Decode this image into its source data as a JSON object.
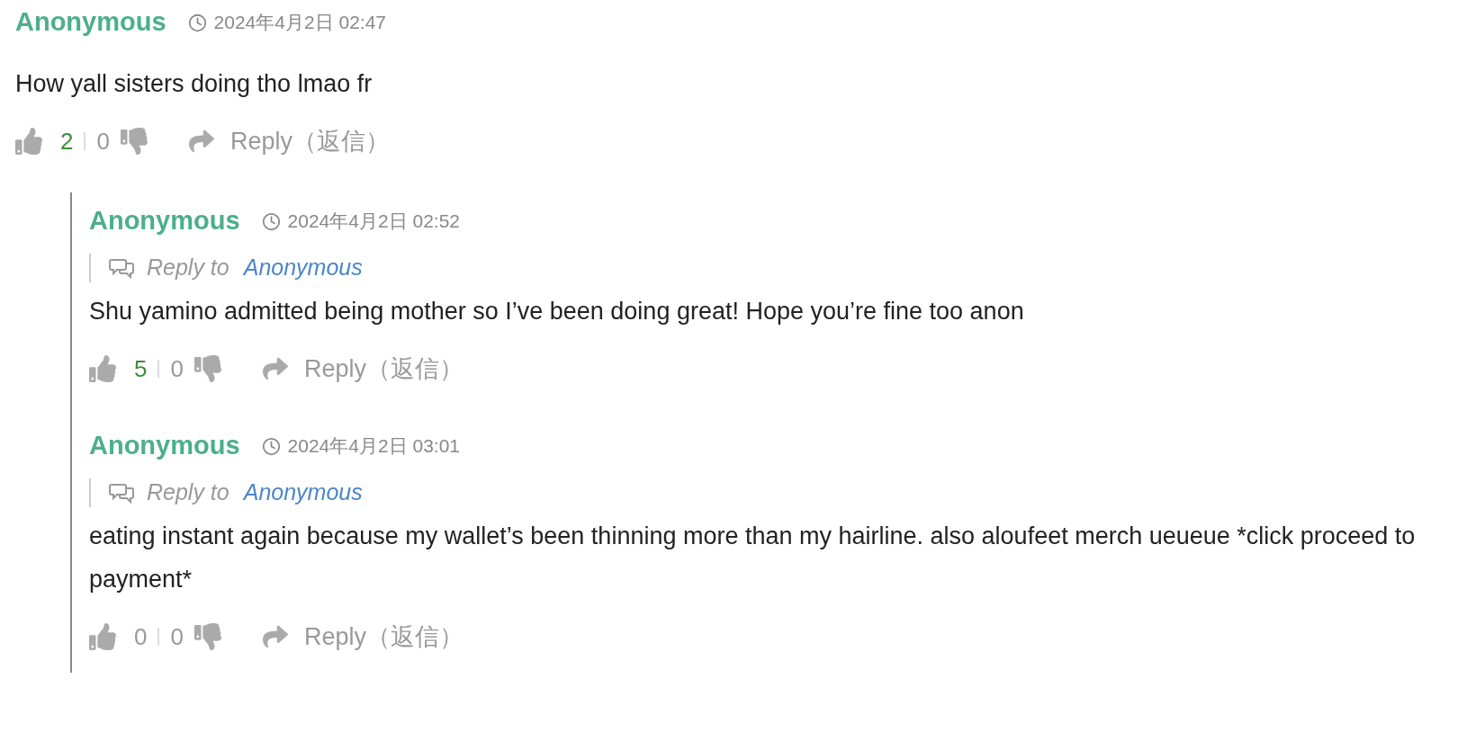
{
  "comments": [
    {
      "author": "Anonymous",
      "time": "2024年4月2日 02:47",
      "text": "How yall sisters doing tho lmao fr",
      "likes": {
        "count": "2",
        "highlighted": true
      },
      "dislikes": "0",
      "reply_button": "Reply（返信）",
      "replies": [
        {
          "author": "Anonymous",
          "time": "2024年4月2日 02:52",
          "reply_to": {
            "label": "Reply to",
            "target": "Anonymous"
          },
          "text": "Shu yamino admitted being mother so I’ve been doing great! Hope you’re fine too anon",
          "likes": {
            "count": "5",
            "highlighted": true
          },
          "dislikes": "0",
          "reply_button": "Reply（返信）"
        },
        {
          "author": "Anonymous",
          "time": "2024年4月2日 03:01",
          "reply_to": {
            "label": "Reply to",
            "target": "Anonymous"
          },
          "text": "eating instant again because my wallet’s been thinning more than my hairline. also aloufeet merch ueueue *click proceed to payment*",
          "likes": {
            "count": "0",
            "highlighted": false
          },
          "dislikes": "0",
          "reply_button": "Reply（返信）"
        }
      ]
    }
  ]
}
